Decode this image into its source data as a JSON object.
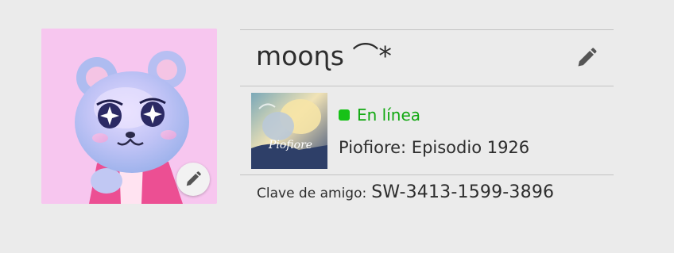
{
  "profile": {
    "username": "mooɳs ⌒*",
    "status": {
      "text": "En línea",
      "color": "#17c217"
    },
    "game": {
      "title": "Piofiore: Episodio 1926",
      "thumbnail_logo": "Piofiore"
    },
    "friend_code": {
      "label": "Clave de amigo:",
      "value": "SW-3413-1599-3896"
    }
  },
  "icons": {
    "avatar_edit": "pencil-icon",
    "name_edit": "pencil-icon"
  },
  "colors": {
    "background": "#ebebeb",
    "avatar_background": "#f7c6ef",
    "online_green": "#17c217",
    "divider": "#c3c3c3"
  }
}
